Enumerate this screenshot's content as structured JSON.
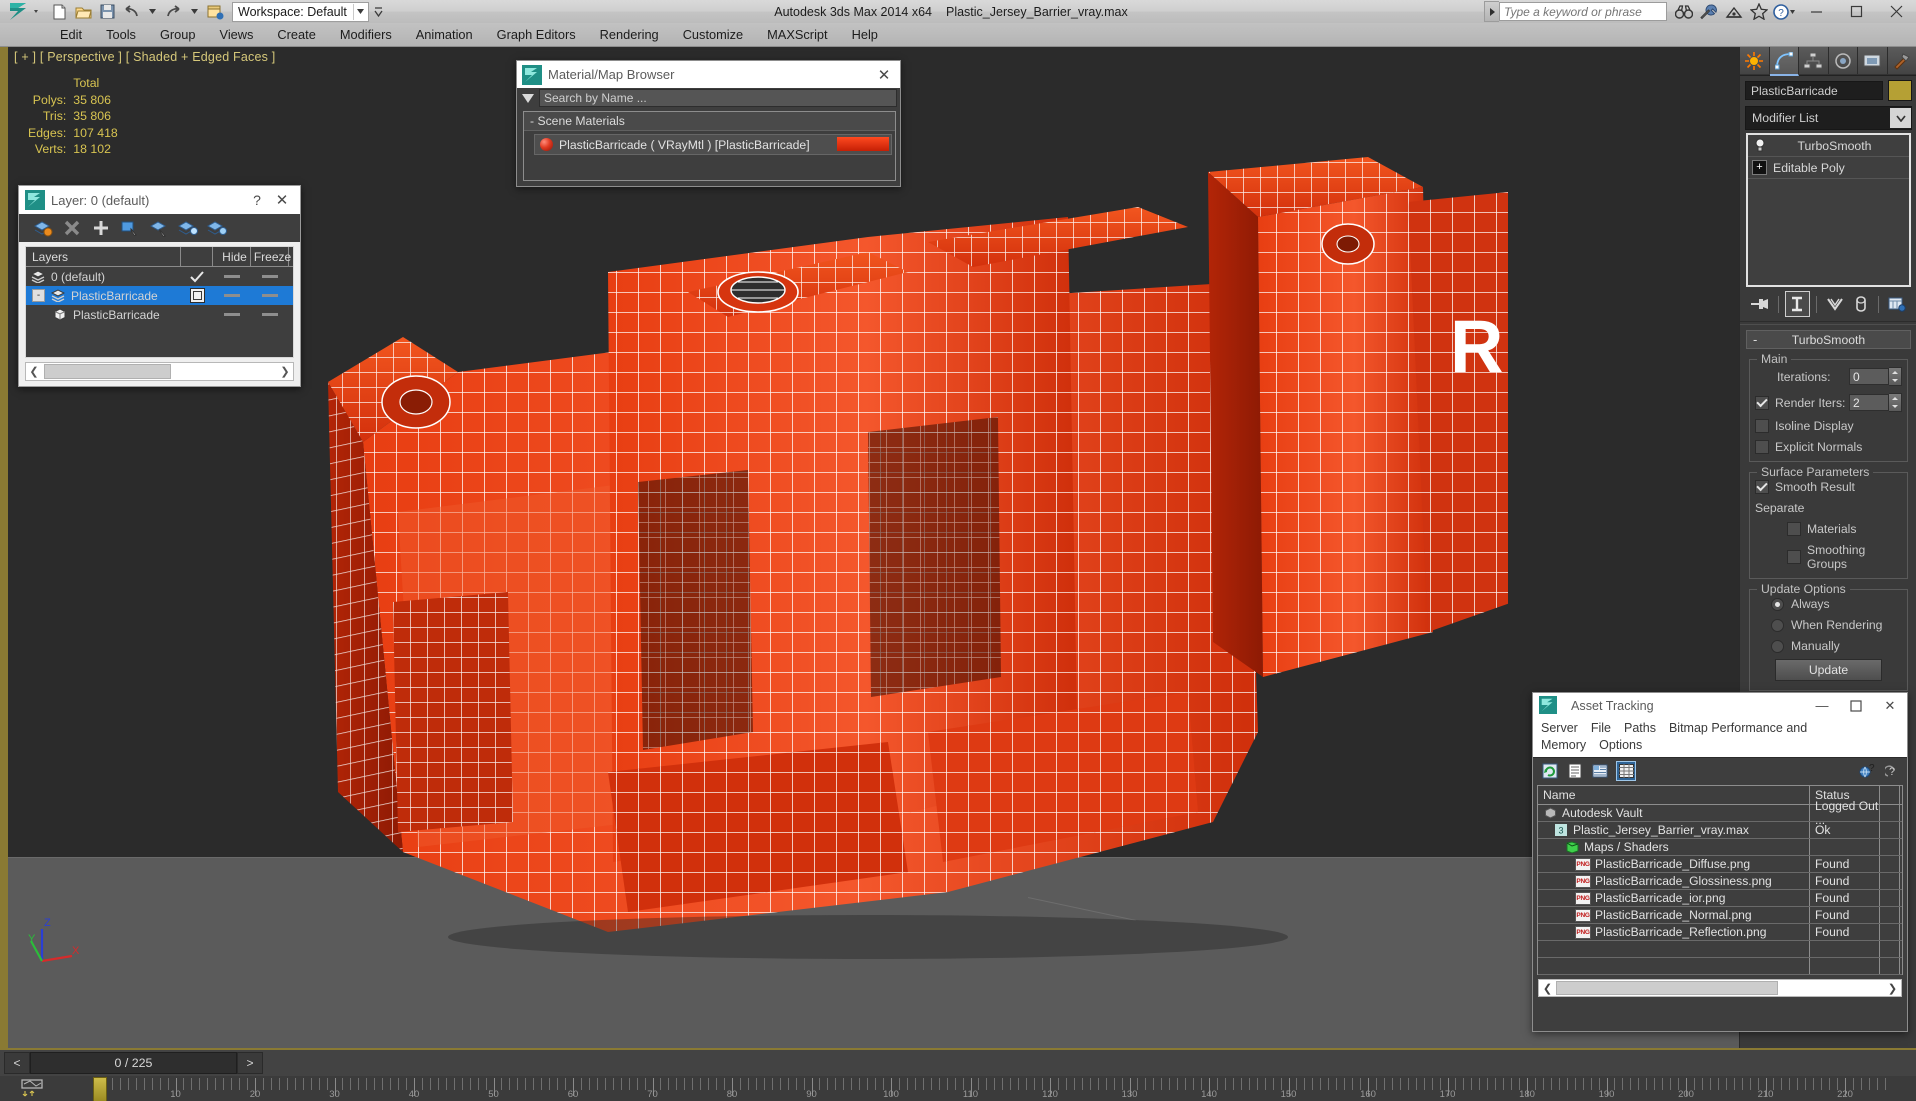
{
  "titlebar": {
    "app_title": "Autodesk 3ds Max  2014 x64",
    "file_name": "Plastic_Jersey_Barrier_vray.max",
    "workspace_label": "Workspace: Default",
    "search_placeholder": "Type a keyword or phrase",
    "quick_access": [
      {
        "name": "new-file-icon"
      },
      {
        "name": "open-file-icon"
      },
      {
        "name": "save-file-icon"
      },
      {
        "name": "undo-icon"
      },
      {
        "name": "redo-icon"
      },
      {
        "name": "set-project-folder-icon"
      }
    ],
    "right_icons": [
      {
        "name": "binoculars-icon"
      },
      {
        "name": "wrench-icon"
      },
      {
        "name": "satellite-dish-icon"
      },
      {
        "name": "star-icon"
      },
      {
        "name": "help-icon"
      }
    ],
    "window_buttons": {
      "minimize": "—",
      "maximize": "❐",
      "close": "✕"
    }
  },
  "menubar": {
    "items": [
      "Edit",
      "Tools",
      "Group",
      "Views",
      "Create",
      "Modifiers",
      "Animation",
      "Graph Editors",
      "Rendering",
      "Customize",
      "MAXScript",
      "Help"
    ]
  },
  "viewport": {
    "label": "[ + ] [ Perspective ] [ Shaded + Edged Faces ]",
    "stats_header": "Total",
    "stats": [
      {
        "key": "Polys:",
        "value": "35 806"
      },
      {
        "key": "Tris:",
        "value": "35 806"
      },
      {
        "key": "Edges:",
        "value": "107 418"
      },
      {
        "key": "Verts:",
        "value": "18 102"
      }
    ],
    "axis": {
      "x": "X",
      "y": "Y",
      "z": "Z"
    },
    "model_colors": {
      "body": "#e8380f",
      "body_light": "#f4532a",
      "body_dark": "#a82306",
      "wire": "#ffffff"
    },
    "background": "#2b2b2b",
    "floor": "#5b5b5b"
  },
  "layer_dialog": {
    "title": "Layer: 0 (default)",
    "help_glyph": "?",
    "close_glyph": "✕",
    "toolbar_icons": [
      {
        "name": "new-layer-icon"
      },
      {
        "name": "delete-layer-icon"
      },
      {
        "name": "add-selection-to-layer-icon"
      },
      {
        "name": "select-objects-in-layer-icon"
      },
      {
        "name": "select-highlighted-objects-layers-icon"
      },
      {
        "name": "highlight-selected-objects-layers-icon"
      },
      {
        "name": "layer-properties-icon"
      }
    ],
    "columns": [
      "Layers",
      "",
      "Hide",
      "Freeze"
    ],
    "rows": [
      {
        "name": "0 (default)",
        "indent": 0,
        "type": "layer",
        "current": true,
        "hide": "—",
        "freeze": "—",
        "selected": false,
        "expander": ""
      },
      {
        "name": "PlasticBarricade",
        "indent": 0,
        "type": "layer",
        "current": false,
        "hide": "—",
        "freeze": "—",
        "selected": true,
        "expander": "-"
      },
      {
        "name": "PlasticBarricade",
        "indent": 1,
        "type": "object",
        "current": false,
        "hide": "—",
        "freeze": "—",
        "selected": false,
        "expander": ""
      }
    ]
  },
  "material_browser": {
    "title": "Material/Map Browser",
    "close_glyph": "✕",
    "search_placeholder": "Search by Name ...",
    "group": "-  Scene Materials",
    "items": [
      {
        "label": "PlasticBarricade  ( VRayMtl )  [PlasticBarricade]",
        "swatch": "#e8380f"
      }
    ]
  },
  "command_panel": {
    "tabs": [
      {
        "name": "create-tab",
        "selected": false
      },
      {
        "name": "modify-tab",
        "selected": true
      },
      {
        "name": "hierarchy-tab",
        "selected": false
      },
      {
        "name": "motion-tab",
        "selected": false
      },
      {
        "name": "display-tab",
        "selected": false
      },
      {
        "name": "utilities-tab",
        "selected": false
      }
    ],
    "object_name": "PlasticBarricade",
    "object_color": "#b5a034",
    "modifier_list_label": "Modifier List",
    "stack": [
      {
        "label": "TurboSmooth",
        "icon": "lightbulb-icon",
        "expandable": false
      },
      {
        "label": "Editable Poly",
        "icon": "plus-icon",
        "expandable": true
      }
    ],
    "stack_tools": [
      {
        "name": "pin-stack-icon"
      },
      {
        "name": "show-end-result-icon",
        "active": true
      },
      {
        "name": "make-unique-icon"
      },
      {
        "name": "remove-modifier-icon"
      },
      {
        "name": "configure-modifier-sets-icon"
      }
    ],
    "rollout": {
      "title": "TurboSmooth",
      "collapse_glyph": "-",
      "groups": [
        {
          "title": "Main",
          "fields": [
            {
              "type": "spin",
              "label": "Iterations:",
              "value": "0",
              "checkbox": null
            },
            {
              "type": "spin",
              "label": "Render Iters:",
              "value": "2",
              "checkbox": true
            },
            {
              "type": "check",
              "label": "Isoline Display",
              "checked": false
            },
            {
              "type": "check",
              "label": "Explicit Normals",
              "checked": false
            }
          ]
        },
        {
          "title": "Surface Parameters",
          "fields": [
            {
              "type": "check",
              "label": "Smooth Result",
              "checked": true
            },
            {
              "type": "text",
              "label": "Separate"
            },
            {
              "type": "check-indent",
              "label": "Materials",
              "checked": false
            },
            {
              "type": "check-indent",
              "label": "Smoothing Groups",
              "checked": false
            }
          ]
        },
        {
          "title": "Update Options",
          "fields": [
            {
              "type": "radio",
              "label": "Always",
              "checked": true
            },
            {
              "type": "radio",
              "label": "When Rendering",
              "checked": false
            },
            {
              "type": "radio",
              "label": "Manually",
              "checked": false
            },
            {
              "type": "button",
              "label": "Update"
            }
          ]
        }
      ]
    }
  },
  "asset_tracking": {
    "title": "Asset Tracking",
    "window_buttons": {
      "minimize": "—",
      "maximize": "❐",
      "close": "✕"
    },
    "menu": [
      "Server",
      "File",
      "Paths",
      "Bitmap Performance and Memory",
      "Options"
    ],
    "toolbar_icons": [
      {
        "name": "refresh-icon",
        "selected": false
      },
      {
        "name": "list-view-icon",
        "selected": false
      },
      {
        "name": "detail-view-icon",
        "selected": false
      },
      {
        "name": "grid-view-icon",
        "selected": true
      }
    ],
    "toolbar_right_icons": [
      {
        "name": "help-globe-icon"
      },
      {
        "name": "help-icon"
      }
    ],
    "columns": [
      "Name",
      "Status",
      ""
    ],
    "rows": [
      {
        "name": "Autodesk Vault",
        "status": "Logged Out ...",
        "indent": 0,
        "icon": "vault-icon"
      },
      {
        "name": "Plastic_Jersey_Barrier_vray.max",
        "status": "Ok",
        "indent": 1,
        "icon": "max-file-icon"
      },
      {
        "name": "Maps / Shaders",
        "status": "",
        "indent": 2,
        "icon": "maps-shaders-icon"
      },
      {
        "name": "PlasticBarricade_Diffuse.png",
        "status": "Found",
        "indent": 3,
        "icon": "png-icon"
      },
      {
        "name": "PlasticBarricade_Glossiness.png",
        "status": "Found",
        "indent": 3,
        "icon": "png-icon"
      },
      {
        "name": "PlasticBarricade_ior.png",
        "status": "Found",
        "indent": 3,
        "icon": "png-icon"
      },
      {
        "name": "PlasticBarricade_Normal.png",
        "status": "Found",
        "indent": 3,
        "icon": "png-icon"
      },
      {
        "name": "PlasticBarricade_Reflection.png",
        "status": "Found",
        "indent": 3,
        "icon": "png-icon"
      },
      {
        "name": "",
        "status": "",
        "indent": 0,
        "icon": ""
      },
      {
        "name": "",
        "status": "",
        "indent": 0,
        "icon": ""
      }
    ]
  },
  "timeline": {
    "prev_glyph": "<",
    "next_glyph": ">",
    "frame_display": "0 / 225",
    "tick_labels": [
      "10",
      "20",
      "30",
      "40",
      "50",
      "60",
      "70",
      "80",
      "90",
      "100",
      "110",
      "120",
      "130",
      "140",
      "150",
      "160",
      "170",
      "180",
      "190",
      "200",
      "210",
      "220"
    ],
    "current_frame": 0,
    "total_frames": 225
  }
}
